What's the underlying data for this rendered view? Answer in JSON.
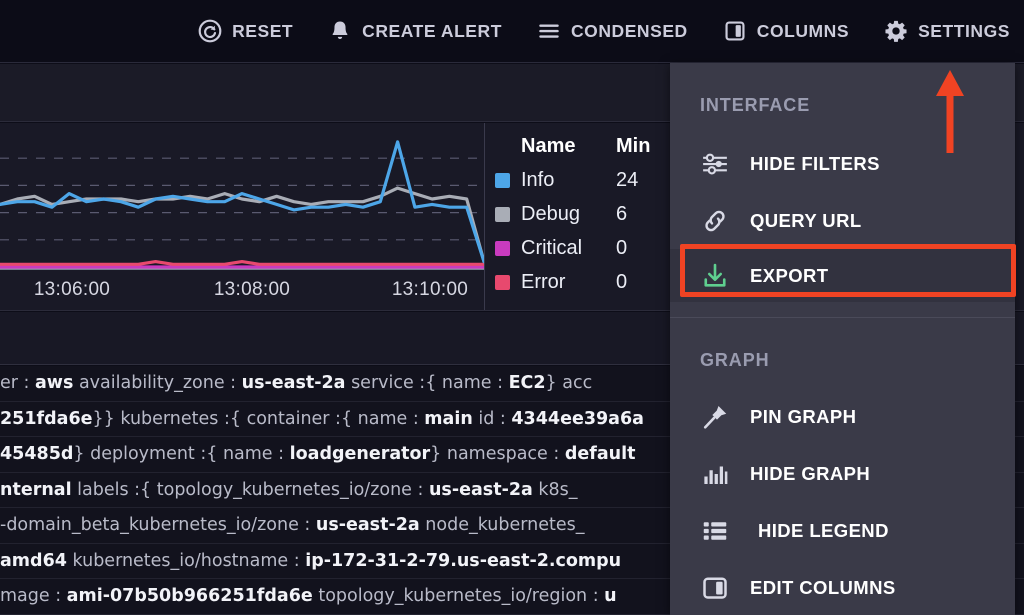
{
  "toolbar": {
    "items": [
      {
        "label": "RESET",
        "icon": "reset-icon"
      },
      {
        "label": "CREATE ALERT",
        "icon": "bell-icon"
      },
      {
        "label": "CONDENSED",
        "icon": "hamburger-icon"
      },
      {
        "label": "COLUMNS",
        "icon": "columns-icon"
      },
      {
        "label": "SETTINGS",
        "icon": "gear-icon"
      }
    ]
  },
  "legend": {
    "headers": {
      "name": "Name",
      "min": "Min"
    },
    "rows": [
      {
        "name": "Info",
        "min": "24",
        "color": "#4da6e8"
      },
      {
        "name": "Debug",
        "min": "6",
        "color": "#a9adb6"
      },
      {
        "name": "Critical",
        "min": "0",
        "color": "#c93bbf"
      },
      {
        "name": "Error",
        "min": "0",
        "color": "#e8496e"
      }
    ]
  },
  "chart_data": {
    "type": "line",
    "title": "",
    "xlabel": "",
    "ylabel": "",
    "grid": true,
    "legend_position": "right",
    "xticks": [
      "13:06:00",
      "13:08:00",
      "13:10:00"
    ],
    "xtick_positions": [
      72,
      252,
      430
    ],
    "x": [
      0,
      1,
      2,
      3,
      4,
      5,
      6,
      7,
      8,
      9,
      10,
      11,
      12,
      13,
      14,
      15,
      16,
      17,
      18,
      19,
      20,
      21,
      22,
      23,
      24,
      25,
      26,
      27,
      28
    ],
    "series": [
      {
        "name": "Info",
        "color": "#4da6e8",
        "values": [
          23,
          24,
          24,
          22,
          27,
          24,
          25,
          24,
          22,
          25,
          26,
          25,
          24,
          24,
          27,
          25,
          23,
          21,
          22,
          22,
          23,
          22,
          24,
          46,
          22,
          23,
          22,
          22,
          2
        ]
      },
      {
        "name": "Debug",
        "color": "#a9adb6",
        "values": [
          23,
          25,
          26,
          23,
          24,
          25,
          25,
          25,
          24,
          25,
          25,
          26,
          25,
          27,
          25,
          24,
          26,
          24,
          23,
          24,
          24,
          24,
          26,
          29,
          27,
          25,
          26,
          25,
          2
        ]
      },
      {
        "name": "Critical",
        "color": "#c93bbf",
        "values": [
          0,
          0,
          0,
          0,
          0,
          0,
          0,
          0,
          0,
          0,
          0,
          0,
          0,
          0,
          0,
          0,
          0,
          0,
          0,
          0,
          0,
          0,
          0,
          0,
          0,
          0,
          0,
          0,
          0
        ]
      },
      {
        "name": "Error",
        "color": "#e8496e",
        "values": [
          1,
          1,
          1,
          1,
          1,
          1,
          1,
          1,
          1,
          2,
          1,
          1,
          1,
          1,
          2,
          1,
          1,
          1,
          1,
          1,
          1,
          1,
          1,
          1,
          1,
          1,
          1,
          1,
          1
        ]
      }
    ],
    "ylim": [
      0,
      50
    ]
  },
  "menu": {
    "sections": [
      {
        "label": "INTERFACE",
        "items": [
          {
            "label": "HIDE FILTERS",
            "icon": "sliders-icon",
            "highlighted": false
          },
          {
            "label": "QUERY URL",
            "icon": "link-icon",
            "highlighted": false
          },
          {
            "label": "EXPORT",
            "icon": "download-icon",
            "highlighted": true
          }
        ]
      },
      {
        "label": "GRAPH",
        "items": [
          {
            "label": "PIN GRAPH",
            "icon": "pin-icon",
            "highlighted": false
          },
          {
            "label": "HIDE GRAPH",
            "icon": "bar-chart-icon",
            "highlighted": false
          },
          {
            "label": "HIDE LEGEND",
            "icon": "list-icon",
            "highlighted": false
          },
          {
            "label": "EDIT COLUMNS",
            "icon": "columns-icon",
            "highlighted": false
          }
        ]
      }
    ]
  },
  "annotations": {
    "highlight_color": "#f04323",
    "arrow_color": "#f04323",
    "target": "EXPORT"
  },
  "logs": {
    "rows": [
      "er : <b>aws</b> availability_zone : <b>us-east-2a</b> service :{ name : <b>EC2</b>} acc",
      "<b>251fda6e</b>}} kubernetes :{ container :{ name : <b>main</b> id : <b>4344ee39a6a</b>",
      "<b>45485d</b>} deployment :{ name : <b>loadgenerator</b>} namespace : <b>default</b>",
      "<b>nternal</b> labels :{ topology_kubernetes_io/zone : <b>us-east-2a</b> k8s_",
      "-domain_beta_kubernetes_io/zone : <b>us-east-2a</b> node_kubernetes_",
      "<b>amd64</b> kubernetes_io/hostname : <b>ip-172-31-2-79.us-east-2.compu</b>",
      "mage : <b>ami-07b50b966251fda6e</b> topology_kubernetes_io/region : <b>u</b>"
    ]
  }
}
